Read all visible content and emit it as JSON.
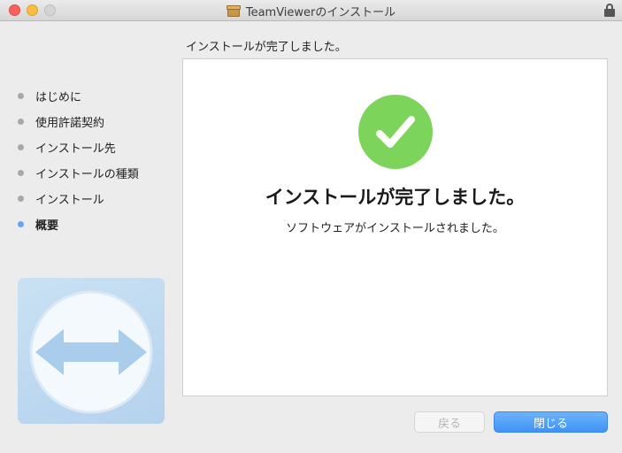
{
  "window": {
    "title": "TeamViewerのインストール"
  },
  "heading": "インストールが完了しました。",
  "steps": [
    {
      "label": "はじめに",
      "active": false
    },
    {
      "label": "使用許諾契約",
      "active": false
    },
    {
      "label": "インストール先",
      "active": false
    },
    {
      "label": "インストールの種類",
      "active": false
    },
    {
      "label": "インストール",
      "active": false
    },
    {
      "label": "概要",
      "active": true
    }
  ],
  "panel": {
    "title": "インストールが完了しました。",
    "subtitle": "ソフトウェアがインストールされました。"
  },
  "buttons": {
    "back": "戻る",
    "close": "閉じる"
  },
  "colors": {
    "success": "#7dd45a",
    "accent": "#3f93f6",
    "active_step": "#6aa4f0"
  },
  "icons": {
    "package": "package-icon",
    "lock": "lock-icon",
    "check": "checkmark-icon",
    "logo": "teamviewer-logo"
  }
}
